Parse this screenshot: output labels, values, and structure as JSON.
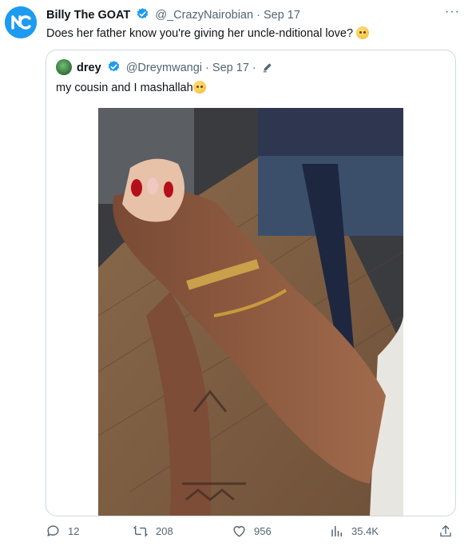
{
  "tweet": {
    "author_name": "Billy The GOAT",
    "author_handle": "@_CrazyNairobian",
    "separator": "·",
    "date": "Sep 17",
    "text": "Does her father know you're giving her uncle-nditional love?",
    "more_label": "···"
  },
  "quoted": {
    "author_name": "drey",
    "author_handle": "@Dreymwangi",
    "separator": "·",
    "date": "Sep 17",
    "dot_after": "·",
    "text": "my cousin and I mashallah"
  },
  "actions": {
    "replies": "12",
    "retweets": "208",
    "likes": "956",
    "views": "35.4K"
  },
  "colors": {
    "accent": "#1d9bf0",
    "muted": "#536471",
    "border": "#cfd9de"
  },
  "icons": [
    "more-icon",
    "verified-icon",
    "edit-icon",
    "reply-icon",
    "retweet-icon",
    "like-icon",
    "views-icon",
    "share-icon"
  ]
}
